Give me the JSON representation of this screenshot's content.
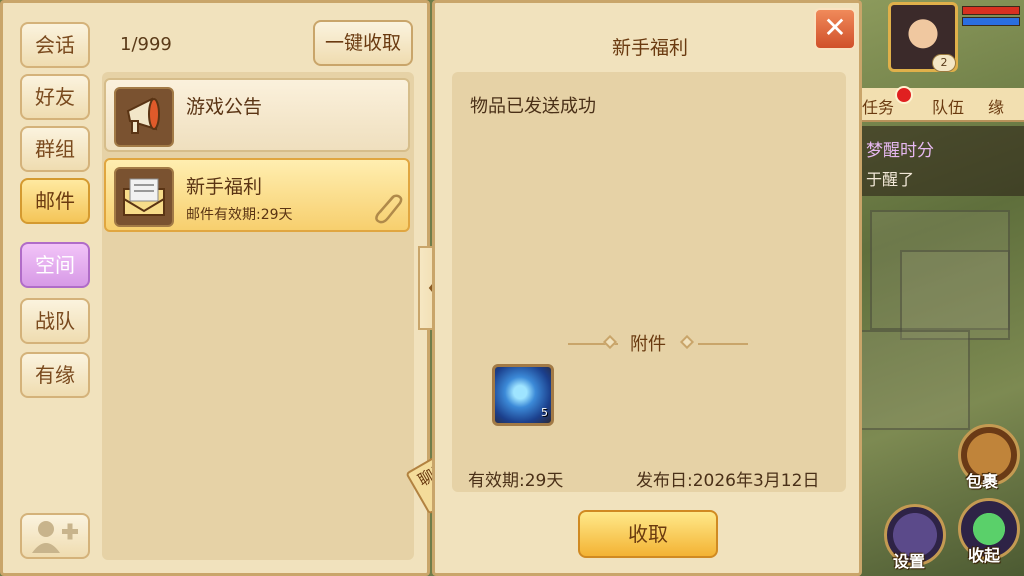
{
  "sidebar": {
    "tabs": [
      {
        "label": "会话",
        "state": "normal"
      },
      {
        "label": "好友",
        "state": "normal"
      },
      {
        "label": "群组",
        "state": "normal"
      },
      {
        "label": "邮件",
        "state": "active"
      },
      {
        "label": "空间",
        "state": "highlight"
      },
      {
        "label": "战队",
        "state": "normal"
      },
      {
        "label": "有缘",
        "state": "normal"
      }
    ]
  },
  "mail": {
    "count": "1/999",
    "collect_all_label": "一键收取",
    "items": [
      {
        "title": "游戏公告",
        "icon": "megaphone-icon"
      },
      {
        "title": "新手福利",
        "validity": "邮件有效期:29天",
        "icon": "envelope-icon",
        "has_attachment": true
      }
    ]
  },
  "chat_tag": "聊天",
  "detail": {
    "title": "新手福利",
    "close_label": "✕",
    "message": "物品已发送成功",
    "attachment_label": "附件",
    "item_qty": "5",
    "validity": "有效期:29天",
    "publish_date": "发布日:2026年3月12日",
    "receive_label": "收取"
  },
  "hud": {
    "level": "2",
    "quest_tabs": [
      "任务",
      "队伍",
      "缘"
    ],
    "quest_title": "梦醒时分",
    "quest_desc": "于醒了",
    "bag_label": "包裹",
    "settings_label": "设置",
    "collapse_label": "收起"
  },
  "colors": {
    "panel_bg": "#f1e2bd",
    "panel_border": "#c9a56a",
    "active_tab": "#f4c558",
    "space_tab": "#d79ae6",
    "hp_red": "#d83020",
    "mp_blue": "#2a6ee0"
  }
}
